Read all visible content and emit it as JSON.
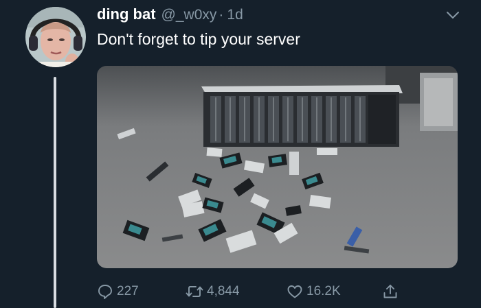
{
  "tweet": {
    "display_name": "ding bat",
    "handle": "@_w0xy",
    "separator": "·",
    "time": "1d",
    "text": "Don't forget to tip your server",
    "media_icon": "photo-of-smashed-server-and-hard-drives"
  },
  "actions": {
    "reply": {
      "icon": "reply-bubble-icon",
      "count": "227"
    },
    "retweet": {
      "icon": "retweet-arrows-icon",
      "count": "4,844"
    },
    "like": {
      "icon": "heart-icon",
      "count": "16.2K"
    },
    "share": {
      "icon": "share-upload-icon"
    }
  },
  "colors": {
    "background": "#15202b",
    "primary_text": "#ffffff",
    "secondary_text": "#8899a6",
    "thread_line": "#d9dde2"
  }
}
